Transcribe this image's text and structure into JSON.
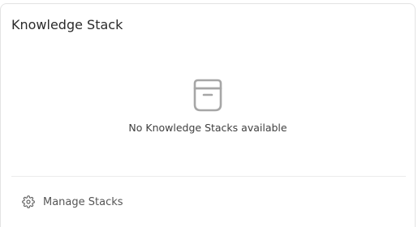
{
  "card": {
    "title": "Knowledge Stack",
    "empty_message": "No Knowledge Stacks available",
    "empty_icon": "archive-box-icon",
    "manage_label": "Manage Stacks",
    "manage_icon": "gear-icon"
  },
  "colors": {
    "border": "#e3e3e3",
    "title_text": "#2b2b2b",
    "muted_text": "#555555",
    "icon_gray": "#a6a6a6"
  }
}
